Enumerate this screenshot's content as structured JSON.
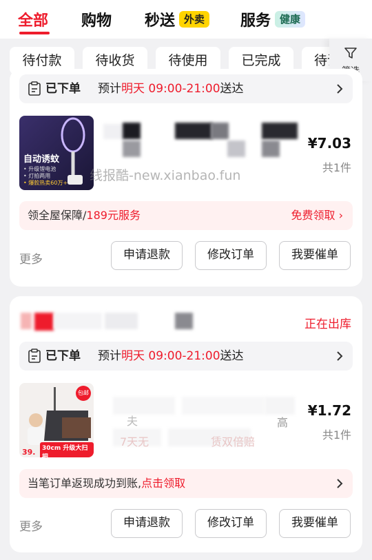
{
  "tabs": [
    {
      "label": "全部",
      "active": true
    },
    {
      "label": "购物"
    },
    {
      "label": "秒送",
      "tag": "外卖"
    },
    {
      "label": "服务",
      "tag": "健康"
    }
  ],
  "filters": [
    "待付款",
    "待收货",
    "待使用",
    "已完成",
    "待评价"
  ],
  "filter_label": "筛选",
  "watermark": "线报酷-new.xianbao.fun",
  "orders": [
    {
      "status": "",
      "ship_status": "已下单",
      "delivery_prefix": "预计",
      "delivery_day": "明天 09:00-21:00",
      "delivery_suffix": "送达",
      "price": "¥7.03",
      "qty": "共1件",
      "promo_left": "领全屋保障/",
      "promo_left_red": "189元服务",
      "promo_right": "免费领取",
      "image_text": {
        "line1": "自动诱蚊",
        "b1": "• 升级锂电池",
        "b2": "• 灯拍两用",
        "b3": "• 爆款热卖60万+"
      },
      "more": "更多",
      "buttons": [
        "申请退款",
        "修改订单",
        "我要催单"
      ]
    },
    {
      "status": "正在出库",
      "ship_status": "已下单",
      "delivery_prefix": "预计",
      "delivery_day": "明天 09:00-21:00",
      "delivery_suffix": "送达",
      "price": "¥1.72",
      "qty": "共1件",
      "title_fragments": [
        "夫",
        "高"
      ],
      "subtitle_fragments": [
        "7天无",
        "赁双倍赔"
      ],
      "promo_text": "当笔订单返现成功到账,",
      "promo_link": "点击领取",
      "image_text": {
        "badge": "包邮",
        "big": "30cm 升级大扫把",
        "price": "39."
      },
      "more": "更多",
      "buttons": [
        "申请退款",
        "修改订单",
        "我要催单"
      ]
    }
  ],
  "colors": {
    "accent": "#ee1c2c",
    "yellow_tag": "#ffd400",
    "bg": "#f1f1f3"
  }
}
